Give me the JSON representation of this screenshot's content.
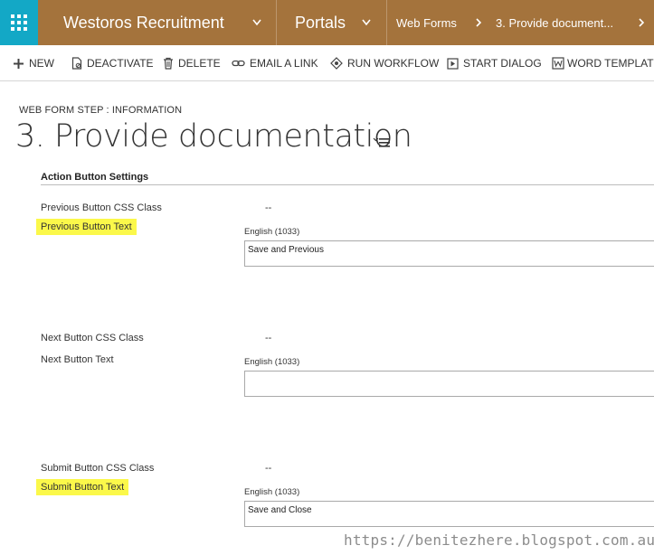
{
  "topnav": {
    "app_name": "Westoros Recruitment",
    "area": "Portals",
    "breadcrumb_1": "Web Forms",
    "breadcrumb_2": "3. Provide document..."
  },
  "commands": {
    "new": "NEW",
    "deactivate": "DEACTIVATE",
    "delete": "DELETE",
    "email_link": "EMAIL A LINK",
    "run_workflow": "RUN WORKFLOW",
    "start_dialog": "START DIALOG",
    "word_templates": "WORD TEMPLATES"
  },
  "header": {
    "entity_label": "WEB FORM STEP : INFORMATION",
    "title": "3. Provide documentation"
  },
  "section": {
    "title": "Action Button Settings"
  },
  "fields": {
    "prev_css_label": "Previous Button CSS Class",
    "prev_css_value": "--",
    "prev_text_label": "Previous Button Text",
    "prev_text_lang": "English (1033)",
    "prev_text_value": "Save and Previous",
    "next_css_label": "Next Button CSS Class",
    "next_css_value": "--",
    "next_text_label": "Next Button Text",
    "next_text_lang": "English (1033)",
    "next_text_value": "",
    "submit_css_label": "Submit Button CSS Class",
    "submit_css_value": "--",
    "submit_text_label": "Submit Button Text",
    "submit_text_lang": "English (1033)",
    "submit_text_value": "Save and Close"
  },
  "watermark": "https://benitezhere.blogspot.com.au",
  "colors": {
    "nav_bg": "#a4733c",
    "waffle_bg": "#13a8c6",
    "highlight": "#fbf84a"
  },
  "icons": {
    "waffle": "app-launcher-icon",
    "new": "plus-icon",
    "deactivate": "document-deactivate-icon",
    "delete": "trash-icon",
    "email_link": "link-icon",
    "run_workflow": "workflow-icon",
    "start_dialog": "play-icon",
    "word_templates": "word-icon",
    "title_menu": "form-selector-icon"
  }
}
